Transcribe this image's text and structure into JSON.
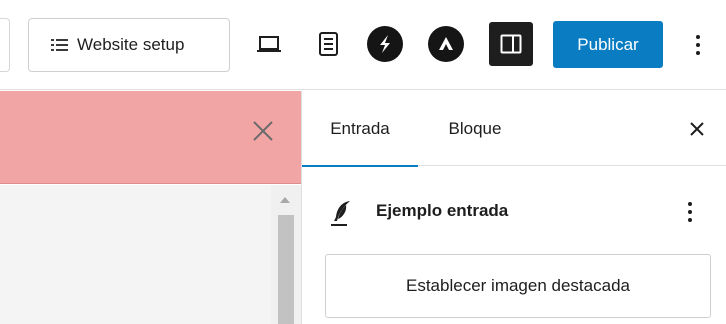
{
  "toolbar": {
    "website_setup_label": "Website setup",
    "publish_label": "Publicar",
    "accent_color": "#0a7cc2"
  },
  "icons": {
    "website_setup": "list-icon",
    "view": "desktop-icon",
    "details": "document-icon",
    "plugin_s": "s-logo-icon",
    "plugin_a": "a-logo-icon",
    "settings": "sidebar-panel-icon",
    "options": "vertical-ellipsis-icon",
    "close": "close-icon",
    "post": "feather-icon"
  },
  "notice": {
    "background": "#f2a5a5"
  },
  "sidebar": {
    "tabs": [
      {
        "label": "Entrada",
        "active": true
      },
      {
        "label": "Bloque",
        "active": false
      }
    ],
    "post_title": "Ejemplo entrada",
    "featured_image_label": "Establecer imagen destacada"
  }
}
